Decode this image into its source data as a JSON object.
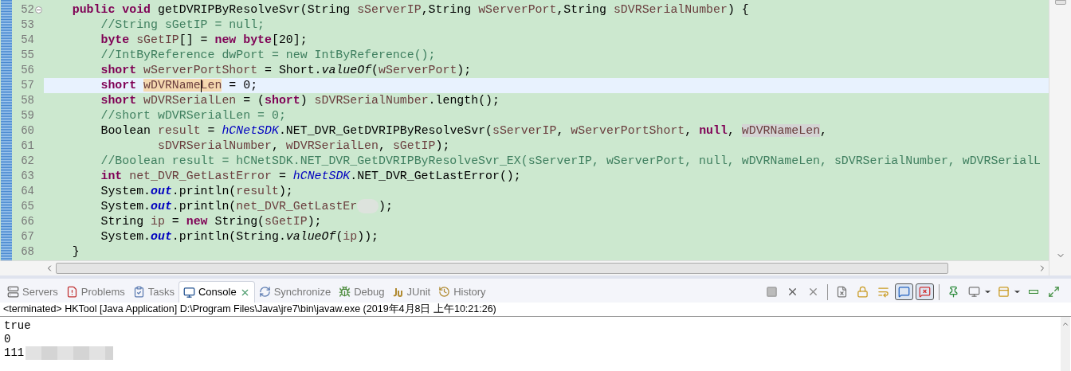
{
  "editor": {
    "lines": [
      {
        "number": "52",
        "fold": true,
        "current": false,
        "tokens": [
          {
            "kind": "keyword",
            "text": "    public "
          },
          {
            "kind": "keyword",
            "text": "void"
          },
          {
            "kind": "plain",
            "text": " getDVRIPByResolveSvr(String "
          },
          {
            "kind": "local",
            "text": "sServerIP"
          },
          {
            "kind": "plain",
            "text": ",String "
          },
          {
            "kind": "local",
            "text": "wServerPort"
          },
          {
            "kind": "plain",
            "text": ",String "
          },
          {
            "kind": "local",
            "text": "sDVRSerialNumber"
          },
          {
            "kind": "plain",
            "text": ") {"
          }
        ]
      },
      {
        "number": "53",
        "fold": false,
        "current": false,
        "tokens": [
          {
            "kind": "comment",
            "text": "        //String sGetIP = null;"
          }
        ]
      },
      {
        "number": "54",
        "fold": false,
        "current": false,
        "tokens": [
          {
            "kind": "keyword",
            "text": "        byte "
          },
          {
            "kind": "local",
            "text": "sGetIP"
          },
          {
            "kind": "plain",
            "text": "[] = "
          },
          {
            "kind": "keyword",
            "text": "new byte"
          },
          {
            "kind": "plain",
            "text": "[20];"
          }
        ]
      },
      {
        "number": "55",
        "fold": false,
        "current": false,
        "tokens": [
          {
            "kind": "comment",
            "text": "        //IntByReference dwPort = new IntByReference();"
          }
        ]
      },
      {
        "number": "56",
        "fold": false,
        "current": false,
        "tokens": [
          {
            "kind": "keyword",
            "text": "        short "
          },
          {
            "kind": "local",
            "text": "wServerPortShort"
          },
          {
            "kind": "plain",
            "text": " = Short."
          },
          {
            "kind": "static_method",
            "text": "valueOf"
          },
          {
            "kind": "plain",
            "text": "("
          },
          {
            "kind": "local",
            "text": "wServerPort"
          },
          {
            "kind": "plain",
            "text": ");"
          }
        ]
      },
      {
        "number": "57",
        "fold": false,
        "current": true,
        "tokens": [
          {
            "kind": "keyword",
            "text": "        short "
          },
          {
            "kind": "local",
            "text": "wDVRName",
            "highlighted": true,
            "write_access": true,
            "caret": false
          },
          {
            "kind": "local",
            "text": "Len",
            "highlighted": true,
            "write_access": true,
            "caret": true
          },
          {
            "kind": "plain",
            "text": " = 0;"
          }
        ]
      },
      {
        "number": "58",
        "fold": false,
        "current": false,
        "tokens": [
          {
            "kind": "keyword",
            "text": "        short "
          },
          {
            "kind": "local",
            "text": "wDVRSerialLen"
          },
          {
            "kind": "plain",
            "text": " = ("
          },
          {
            "kind": "keyword",
            "text": "short"
          },
          {
            "kind": "plain",
            "text": ") "
          },
          {
            "kind": "local",
            "text": "sDVRSerialNumber"
          },
          {
            "kind": "plain",
            "text": ".length();"
          }
        ]
      },
      {
        "number": "59",
        "fold": false,
        "current": false,
        "tokens": [
          {
            "kind": "comment",
            "text": "        //short wDVRSerialLen = 0;"
          }
        ]
      },
      {
        "number": "60",
        "fold": false,
        "current": false,
        "tokens": [
          {
            "kind": "plain",
            "text": "        Boolean "
          },
          {
            "kind": "local",
            "text": "result"
          },
          {
            "kind": "plain",
            "text": " = "
          },
          {
            "kind": "constant",
            "text": "hCNetSDK"
          },
          {
            "kind": "plain",
            "text": ".NET_DVR_GetDVRIPByResolveSvr("
          },
          {
            "kind": "local",
            "text": "sServerIP"
          },
          {
            "kind": "plain",
            "text": ", "
          },
          {
            "kind": "local",
            "text": "wServerPortShort"
          },
          {
            "kind": "plain",
            "text": ", "
          },
          {
            "kind": "keyword",
            "text": "null"
          },
          {
            "kind": "plain",
            "text": ", "
          },
          {
            "kind": "local",
            "text": "wDVRNameLen",
            "highlighted": true,
            "write_access": false,
            "caret": false
          },
          {
            "kind": "plain",
            "text": ","
          }
        ]
      },
      {
        "number": "61",
        "fold": false,
        "current": false,
        "tokens": [
          {
            "kind": "local",
            "text": "                sDVRSerialNumber"
          },
          {
            "kind": "plain",
            "text": ", "
          },
          {
            "kind": "local",
            "text": "wDVRSerialLen"
          },
          {
            "kind": "plain",
            "text": ", "
          },
          {
            "kind": "local",
            "text": "sGetIP"
          },
          {
            "kind": "plain",
            "text": ");"
          }
        ]
      },
      {
        "number": "62",
        "fold": false,
        "current": false,
        "tokens": [
          {
            "kind": "comment",
            "text": "        //Boolean result = hCNetSDK.NET_DVR_GetDVRIPByResolveSvr_EX(sServerIP, wServerPort, null, wDVRNameLen, sDVRSerialNumber, wDVRSerialL"
          }
        ]
      },
      {
        "number": "63",
        "fold": false,
        "current": false,
        "tokens": [
          {
            "kind": "keyword",
            "text": "        int "
          },
          {
            "kind": "local",
            "text": "net_DVR_GetLastError"
          },
          {
            "kind": "plain",
            "text": " = "
          },
          {
            "kind": "constant",
            "text": "hCNetSDK"
          },
          {
            "kind": "plain",
            "text": ".NET_DVR_GetLastError();"
          }
        ]
      },
      {
        "number": "64",
        "fold": false,
        "current": false,
        "tokens": [
          {
            "kind": "plain",
            "text": "        System."
          },
          {
            "kind": "static_field",
            "text": "out"
          },
          {
            "kind": "plain",
            "text": ".println("
          },
          {
            "kind": "local",
            "text": "result"
          },
          {
            "kind": "plain",
            "text": ");"
          }
        ]
      },
      {
        "number": "65",
        "fold": false,
        "current": false,
        "tokens": [
          {
            "kind": "plain",
            "text": "        System."
          },
          {
            "kind": "static_field",
            "text": "out"
          },
          {
            "kind": "plain",
            "text": ".println("
          },
          {
            "kind": "local",
            "text": "net_DVR_GetLastEr"
          },
          {
            "kind": "blur"
          },
          {
            "kind": "plain",
            "text": ");"
          }
        ]
      },
      {
        "number": "66",
        "fold": false,
        "current": false,
        "tokens": [
          {
            "kind": "plain",
            "text": "        String "
          },
          {
            "kind": "local",
            "text": "ip"
          },
          {
            "kind": "plain",
            "text": " = "
          },
          {
            "kind": "keyword",
            "text": "new"
          },
          {
            "kind": "plain",
            "text": " String("
          },
          {
            "kind": "local",
            "text": "sGetIP"
          },
          {
            "kind": "plain",
            "text": ");"
          }
        ]
      },
      {
        "number": "67",
        "fold": false,
        "current": false,
        "tokens": [
          {
            "kind": "plain",
            "text": "        System."
          },
          {
            "kind": "static_field",
            "text": "out"
          },
          {
            "kind": "plain",
            "text": ".println(String."
          },
          {
            "kind": "static_method",
            "text": "valueOf"
          },
          {
            "kind": "plain",
            "text": "("
          },
          {
            "kind": "local",
            "text": "ip"
          },
          {
            "kind": "plain",
            "text": "));"
          }
        ]
      },
      {
        "number": "68",
        "fold": false,
        "current": false,
        "tokens": [
          {
            "kind": "plain",
            "text": "    }"
          }
        ]
      }
    ]
  },
  "views": {
    "tabs": [
      {
        "label": "Servers",
        "selected": false
      },
      {
        "label": "Problems",
        "selected": false
      },
      {
        "label": "Tasks",
        "selected": false
      },
      {
        "label": "Console",
        "selected": true
      },
      {
        "label": "Synchronize",
        "selected": false
      },
      {
        "label": "Debug",
        "selected": false
      },
      {
        "label": "JUnit",
        "selected": false
      },
      {
        "label": "History",
        "selected": false
      }
    ],
    "toolbar": [
      {
        "kind": "button",
        "pressed": false
      },
      {
        "kind": "button",
        "pressed": false
      },
      {
        "kind": "button",
        "pressed": false
      },
      {
        "kind": "separator"
      },
      {
        "kind": "button",
        "pressed": false
      },
      {
        "kind": "button",
        "pressed": false
      },
      {
        "kind": "button",
        "pressed": false
      },
      {
        "kind": "button",
        "pressed": true
      },
      {
        "kind": "button",
        "pressed": true
      },
      {
        "kind": "separator"
      },
      {
        "kind": "button",
        "pressed": false
      },
      {
        "kind": "button",
        "pressed": false,
        "dropdown": true
      },
      {
        "kind": "button",
        "pressed": false,
        "dropdown": true
      },
      {
        "kind": "button",
        "pressed": false
      },
      {
        "kind": "button",
        "pressed": false
      }
    ]
  },
  "console": {
    "header": "<terminated> HKTool [Java Application] D:\\Program Files\\Java\\jre7\\bin\\javaw.exe (2019年4月8日 上午10:21:26)",
    "output": [
      {
        "text": "true",
        "blurred_tail": false
      },
      {
        "text": "0",
        "blurred_tail": false
      },
      {
        "text": "111",
        "blurred_tail": true
      }
    ]
  }
}
